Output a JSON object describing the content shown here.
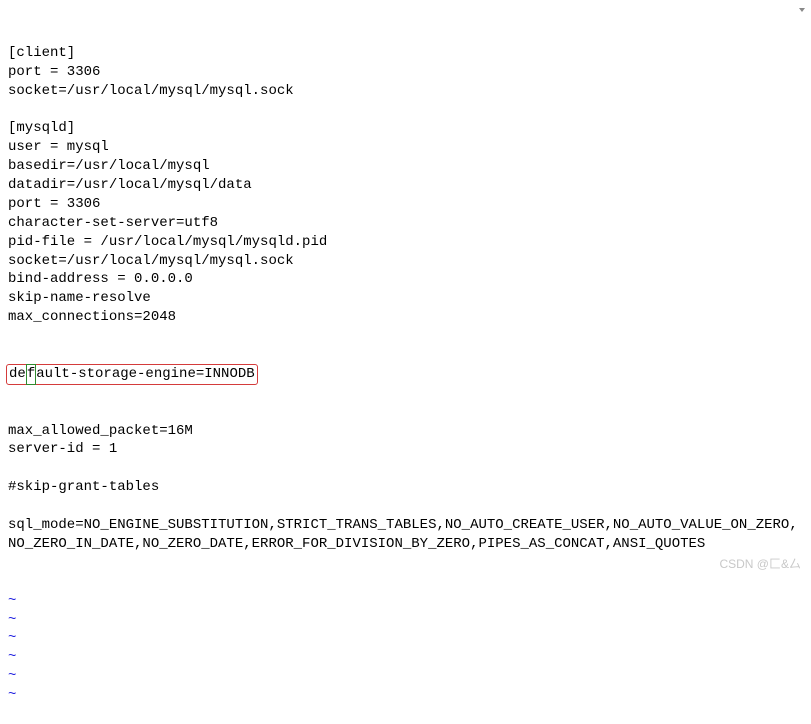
{
  "config": {
    "lines": [
      "[client]",
      "port = 3306",
      "socket=/usr/local/mysql/mysql.sock",
      "",
      "[mysqld]",
      "user = mysql",
      "basedir=/usr/local/mysql",
      "datadir=/usr/local/mysql/data",
      "port = 3306",
      "character-set-server=utf8",
      "pid-file = /usr/local/mysql/mysqld.pid",
      "socket=/usr/local/mysql/mysql.sock",
      "bind-address = 0.0.0.0",
      "skip-name-resolve",
      "max_connections=2048"
    ],
    "highlighted_pre": "de",
    "highlighted_cursor": "f",
    "highlighted_post": "ault-storage-engine=INNODB",
    "lines_after": [
      "max_allowed_packet=16M",
      "server-id = 1",
      "",
      "#skip-grant-tables",
      "",
      "sql_mode=NO_ENGINE_SUBSTITUTION,STRICT_TRANS_TABLES,NO_AUTO_CREATE_USER,NO_AUTO_VALUE_ON_ZERO,NO_ZERO_IN_DATE,NO_ZERO_DATE,ERROR_FOR_DIVISION_BY_ZERO,PIPES_AS_CONCAT,ANSI_QUOTES"
    ],
    "tilde": "~",
    "tilde_count": 6
  },
  "watermark": "CSDN @匚&厶"
}
